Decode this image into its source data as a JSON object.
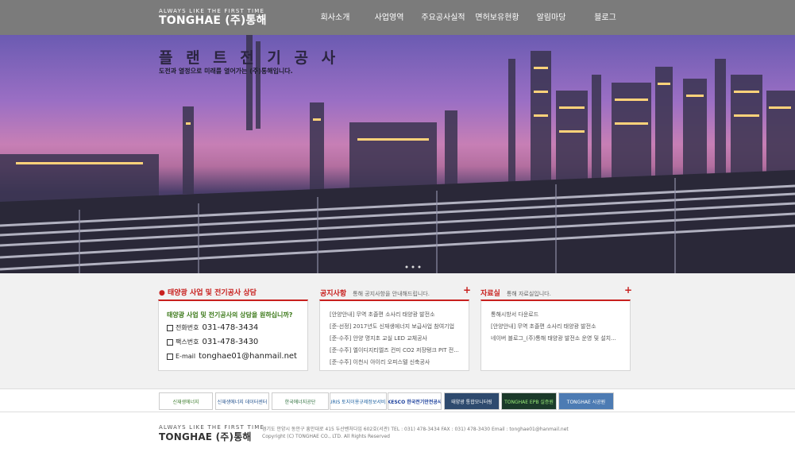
{
  "header": {
    "logo_tagline": "ALWAYS LIKE THE FIRST TIME",
    "logo_name": "TONGHAE (주)통해",
    "nav": [
      "회사소개",
      "사업영역",
      "주요공사실적",
      "면허보유현황",
      "알림마당",
      "블로그"
    ]
  },
  "hero": {
    "title": "플 랜 트 전 기 공 사",
    "subtitle": "도전과 열정으로 미래를 열어가는 (주)통해입니다."
  },
  "consult": {
    "title": "태양광 사업 및 전기공사 상담",
    "question": "태양광 사업 및 전기공사의 상담을 원하십니까?",
    "phone_label": "전화번호",
    "phone": "031-478-3434",
    "fax_label": "팩스번호",
    "fax": "031-478-3430",
    "email_label": "E-mail",
    "email": "tonghae01@hanmail.net"
  },
  "notice": {
    "title": "공지사항",
    "desc": "통해 공지사항을 안내해드립니다.",
    "items": [
      "[안양안내] 무역 초졸편 소사리 태양광 발전소",
      "[준-선정] 2017년도 신재생에너지 보급사업 참여기업",
      "[준-수주] 안양 명지초 교실 LED 교체공사",
      "[준-수주] 엘이디지티엘즈 컨미 CO2 저장탱크 PIT 전...",
      "[준-수주] 이천시 아이리 오피스텔 신축공사"
    ]
  },
  "data": {
    "title": "자료실",
    "desc": "통해 자료실입니다.",
    "items": [
      "통해시방서 다운로드",
      "[안양안내] 무역 초졸편 소사리 태양광 발전소",
      "네이버 블로그_(주)통해 태양광 발전소 운영 및 설치..."
    ]
  },
  "partners": [
    "신재생에너지",
    "신재생에너지 데이터센터",
    "한국에너지공단",
    "LURIS 토지이용규제정보서비스",
    "KESCO 한국전기안전공사",
    "태양광 통합모니터링",
    "TONGHAE EPB 실증원",
    "TONGHAE 시공원"
  ],
  "footer": {
    "tagline": "ALWAYS LIKE THE FIRST TIME",
    "name": "TONGHAE (주)통해",
    "address": "경기도 안양시 동안구 흥안대로 415 두산벤처다임 602호(서관)   TEL : 031) 478-3434    FAX : 031) 478-3430    Email : tonghae01@hanmail.net",
    "copyright": "Copyright (C) TONGHAE CO., LTD. All Rights Reserved"
  },
  "colors": {
    "accent": "#c8201e",
    "header_bg": "#7b7b7b",
    "content_bg": "#f1f1f1"
  }
}
